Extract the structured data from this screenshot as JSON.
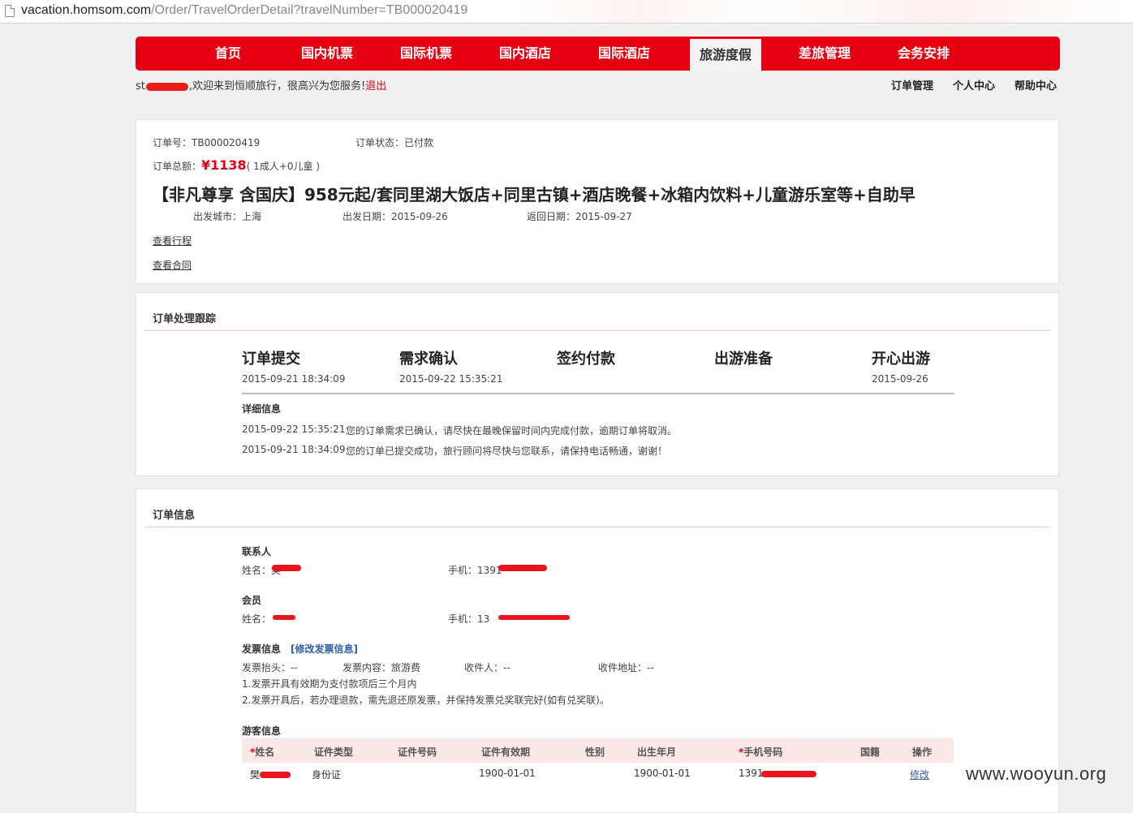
{
  "browser": {
    "url_host": "vacation.homsom.com",
    "url_path": "/Order/TravelOrderDetail?travelNumber=TB000020419"
  },
  "nav": {
    "items": [
      "首页",
      "国内机票",
      "国际机票",
      "国内酒店",
      "国际酒店",
      "旅游度假",
      "差旅管理",
      "会务安排"
    ],
    "active_index": 5,
    "accent_color": "#e60012"
  },
  "header": {
    "welcome_prefix": "st",
    "welcome_text": ",欢迎来到恒顺旅行，很高兴为您服务!",
    "logout": "退出",
    "links": [
      "订单管理",
      "个人中心",
      "帮助中心"
    ]
  },
  "order": {
    "number_label": "订单号：",
    "number": "TB000020419",
    "status_label": "订单状态：",
    "status": "已付款",
    "total_label": "订单总额：",
    "total": "¥1138",
    "people": "( 1成人+0儿童 )",
    "title": "【非凡尊享 含国庆】958元起/套同里湖大饭店+同里古镇+酒店晚餐+冰箱内饮料+儿童游乐室等+自助早",
    "depart_city_label": "出发城市：",
    "depart_city": "上海",
    "depart_date_label": "出发日期：",
    "depart_date": "2015-09-26",
    "return_date_label": "返回日期：",
    "return_date": "2015-09-27",
    "link_itinerary": "查看行程",
    "link_contract": "查看合同"
  },
  "tracking": {
    "title": "订单处理跟踪",
    "steps": [
      {
        "name": "订单提交",
        "time": "2015-09-21 18:34:09"
      },
      {
        "name": "需求确认",
        "time": "2015-09-22 15:35:21"
      },
      {
        "name": "签约付款",
        "time": ""
      },
      {
        "name": "出游准备",
        "time": ""
      },
      {
        "name": "开心出游",
        "time": "2015-09-26"
      }
    ],
    "detail_title": "详细信息",
    "logs": [
      {
        "time": "2015-09-22 15:35:21",
        "text": "您的订单需求已确认，请尽快在最晚保留时间内完成付款，逾期订单将取消。"
      },
      {
        "time": "2015-09-21 18:34:09",
        "text": "您的订单已提交成功，旅行顾问将尽快与您联系，请保持电话畅通，谢谢！"
      }
    ]
  },
  "info": {
    "title": "订单信息",
    "contact_title": "联系人",
    "contact_name_label": "姓名：",
    "contact_name": "樊",
    "contact_phone_label": "手机：",
    "contact_phone": "1391",
    "member_title": "会员",
    "member_name_label": "姓名：",
    "member_phone_label": "手机：",
    "member_phone": "13",
    "invoice_title": "发票信息",
    "invoice_edit": "[修改发票信息]",
    "invoice_head_label": "发票抬头：",
    "invoice_head": "--",
    "invoice_content_label": "发票内容：",
    "invoice_content": "旅游费",
    "receiver_label": "收件人：",
    "receiver": "--",
    "address_label": "收件地址：",
    "address": "--",
    "note1": "1.发票开具有效期为支付款项后三个月内",
    "note2": "2.发票开具后，若办理退款，需先退还原发票，并保持发票兑奖联完好(如有兑奖联)。",
    "travelers_title": "游客信息",
    "columns": [
      "*姓名",
      "证件类型",
      "证件号码",
      "证件有效期",
      "性别",
      "出生年月",
      "*手机号码",
      "国籍",
      "操作"
    ],
    "row": {
      "name": "樊",
      "id_type": "身份证",
      "id_no": "",
      "id_valid": "1900-01-01",
      "gender": "",
      "birth": "1900-01-01",
      "phone": "1391",
      "nation": "",
      "action": "修改"
    }
  },
  "watermark": "www.wooyun.org"
}
